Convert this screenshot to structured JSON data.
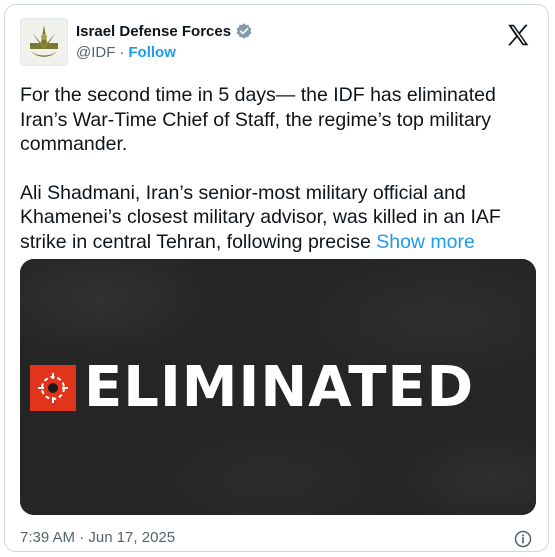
{
  "account": {
    "name": "Israel Defense Forces",
    "handle": "@IDF",
    "separator": "·",
    "follow_label": "Follow"
  },
  "tweet": {
    "paragraph1": "For the second time in 5 days— the IDF has eliminated Iran’s War-Time Chief of Staff, the regime’s top military commander.",
    "paragraph2": "Ali Shadmani, Iran’s senior-most military official and Khamenei’s closest military advisor, was killed in an IAF strike in central Tehran, following precise",
    "show_more_label": "Show more"
  },
  "media": {
    "banner_text": "ELIMINATED"
  },
  "footer": {
    "timestamp": "7:39 AM · Jun 17, 2025"
  },
  "colors": {
    "link": "#1d9bf0",
    "verified_badge": "#829aab",
    "banner_accent": "#e0351c",
    "media_background": "#252525"
  },
  "icons": {
    "logo": "x-logo-icon",
    "verified": "verified-badge-icon",
    "info": "info-icon",
    "target": "crosshair-target-icon"
  }
}
